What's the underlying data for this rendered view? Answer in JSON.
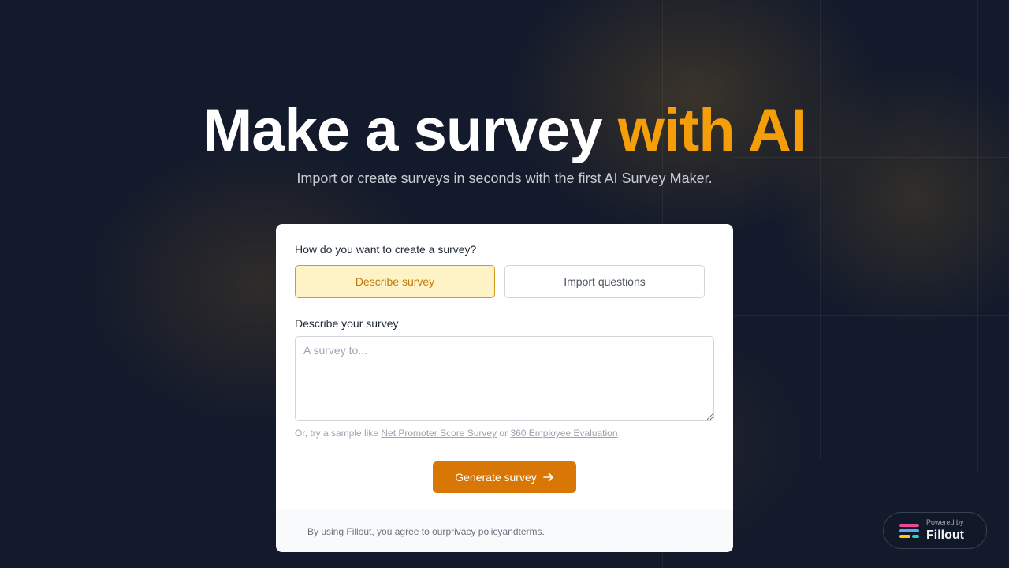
{
  "hero": {
    "title_main": "Make a survey ",
    "title_accent": "with AI",
    "subtitle": "Import or create surveys in seconds with the first AI Survey Maker."
  },
  "form": {
    "question_label": "How do you want to create a survey?",
    "options": [
      {
        "label": "Describe survey",
        "selected": true
      },
      {
        "label": "Import questions",
        "selected": false
      }
    ],
    "description_label": "Describe your survey",
    "description_placeholder": "A survey to...",
    "description_value": "",
    "sample_prefix": "Or, try a sample like ",
    "sample_links": [
      "Net Promoter Score Survey",
      "360 Employee Evaluation"
    ],
    "sample_or": " or ",
    "generate_label": "Generate survey",
    "generate_icon": "arrow-right-icon"
  },
  "footer": {
    "prefix": "By using Fillout, you agree to our ",
    "privacy_label": "privacy policy",
    "and": " and ",
    "terms_label": "terms",
    "suffix": "."
  },
  "badge": {
    "powered_by": "Powered by",
    "brand": "Fillout",
    "logo_icon": "fillout-logo-icon"
  },
  "colors": {
    "accent": "#f59e0b",
    "button": "#d97706",
    "background": "#111827",
    "selected_bg": "#fef3c7"
  }
}
